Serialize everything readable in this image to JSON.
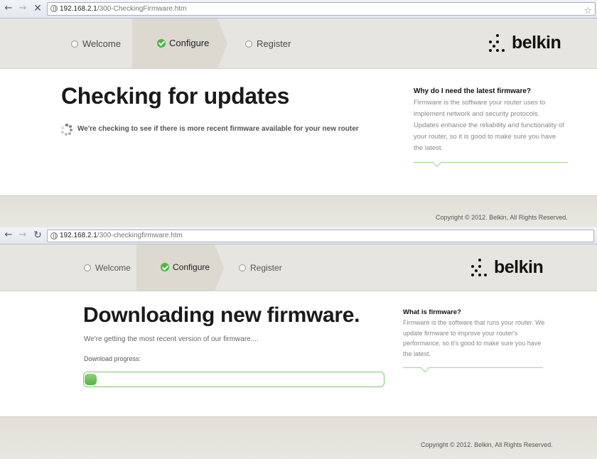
{
  "panels": [
    {
      "browser": {
        "back_icon": "back-arrow-icon",
        "forward_icon": "forward-arrow-icon",
        "stop_icon": "stop-x-icon",
        "url_host": "192.168.2.1",
        "url_path": "/300-CheckingFirmware.htm",
        "bookmark_icon": "star-icon"
      },
      "steps": [
        "Welcome",
        "Configure",
        "Register"
      ],
      "active_step": "Configure",
      "logo": "belkin",
      "heading": "Checking for updates",
      "message": "We're checking to see if there is more recent firmware available for your new router",
      "sidebar": {
        "title": "Why do I need the latest firmware?",
        "body": "Firmware is the software your router uses to implement network and security protocols. Updates enhance the reliability and functionality of your router, so it is good to make sure you have the latest."
      },
      "footer": "Copyright © 2012. Belkin, All Rights Reserved."
    },
    {
      "browser": {
        "back_icon": "back-arrow-icon",
        "forward_icon": "forward-arrow-icon",
        "reload_icon": "reload-icon",
        "url_host": "192.168.2.1",
        "url_path": "/300-checkingfirmware.htm"
      },
      "steps": [
        "Welcome",
        "Configure",
        "Register"
      ],
      "active_step": "Configure",
      "logo": "belkin",
      "heading": "Downloading new firmware.",
      "message": "We're getting the most recent version of our firmware....",
      "progress_label": "Download progress:",
      "progress": 0.04,
      "sidebar": {
        "title": "What is firmware?",
        "body": "Firmware is the software that runs your router. We update firmware to improve your router's performance, so it's good to make sure you have the latest."
      },
      "footer": "Copyright © 2012. Belkin, All Rights Reserved."
    }
  ],
  "colors": {
    "check_green": "#4bb544",
    "progress_green": "#58b247",
    "accent_line": "#9ed68e",
    "header_bg": "#e7e5df"
  }
}
